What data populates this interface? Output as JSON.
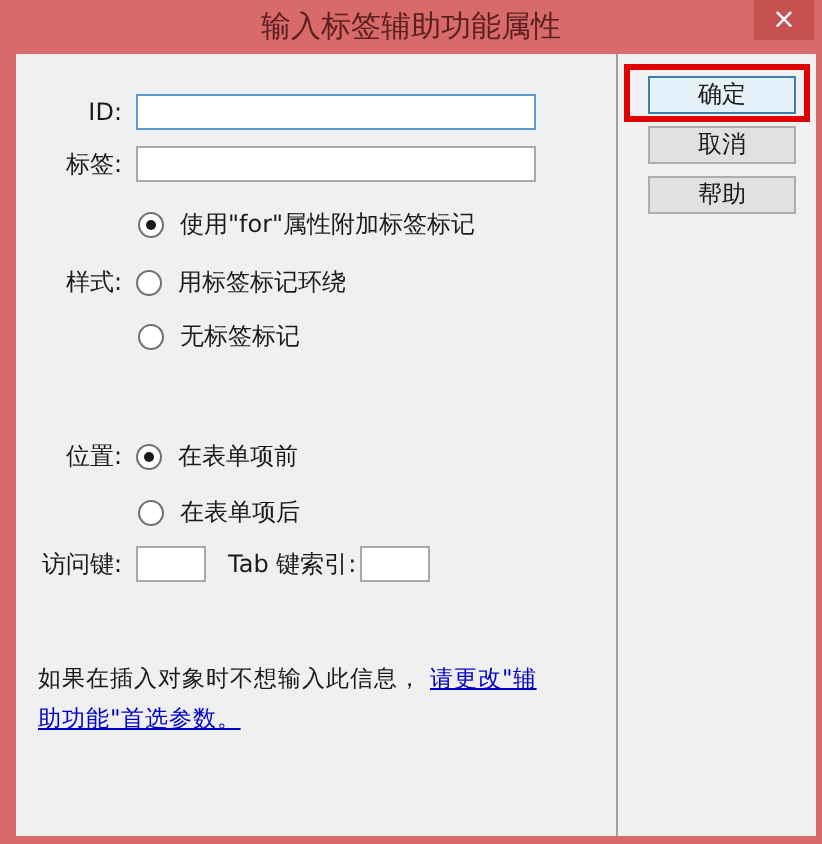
{
  "window": {
    "title": "输入标签辅助功能属性",
    "close": "×"
  },
  "fields": [
    {
      "label": "ID:",
      "focused": true
    },
    {
      "label": "标签:",
      "focused": false
    }
  ],
  "style": {
    "label": "样式:",
    "options": [
      {
        "label": "使用\"for\"属性附加标签标记",
        "selected": true
      },
      {
        "label": "用标签标记环绕",
        "selected": false
      },
      {
        "label": "无标签标记",
        "selected": false
      }
    ]
  },
  "position": {
    "label": "位置:",
    "options": [
      {
        "label": "在表单项前",
        "selected": true
      },
      {
        "label": "在表单项后",
        "selected": false
      }
    ]
  },
  "access_key": {
    "label": "访问键:"
  },
  "tab_index": {
    "label": "Tab 键索引:"
  },
  "note": {
    "text": "如果在插入对象时不想输入此信息，",
    "link_lines": [
      "请更改\"辅",
      "助功能\"首选参数。"
    ]
  },
  "buttons": [
    {
      "label": "确定",
      "highlighted": true,
      "default": true
    },
    {
      "label": "取消",
      "highlighted": false,
      "default": false
    },
    {
      "label": "帮助",
      "highlighted": false,
      "default": false
    }
  ]
}
